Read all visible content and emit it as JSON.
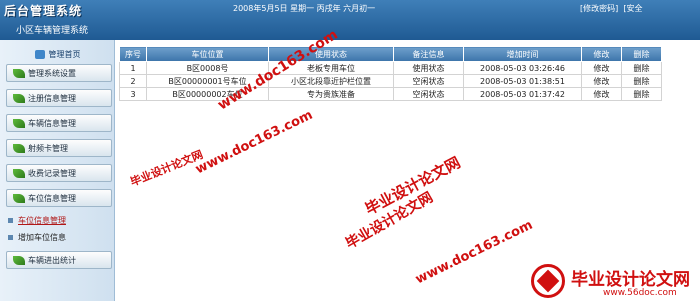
{
  "header": {
    "logo": "后台管理系统",
    "subtitle": "小区车辆管理系统",
    "date": "2008年5月5日  星期一  丙戌年  六月初一",
    "links": [
      "修改密码",
      "安全"
    ]
  },
  "sidebar": {
    "title": "管理首页",
    "menu": [
      {
        "label": "管理系统设置"
      },
      {
        "label": "注册信息管理"
      },
      {
        "label": "车辆信息管理"
      },
      {
        "label": "射频卡管理"
      },
      {
        "label": "收费记录管理"
      },
      {
        "label": "车位信息管理"
      }
    ],
    "sub": [
      {
        "label": "车位信息管理"
      },
      {
        "label": "增加车位信息"
      }
    ],
    "last": {
      "label": "车辆进出统计"
    }
  },
  "table": {
    "columns": [
      "序号",
      "车位位置",
      "使用状态",
      "备注信息",
      "增加时间",
      "修改",
      "删除"
    ],
    "rows": [
      {
        "no": "1",
        "position": "B区0008号",
        "status": "老板专用车位",
        "note": "使用状态",
        "time": "2008-05-03 03:26:46",
        "edit": "修改",
        "del": "删除"
      },
      {
        "no": "2",
        "position": "B区00000001号车位",
        "status": "小区北段靠近护栏位置",
        "note": "空闲状态",
        "time": "2008-05-03 01:38:51",
        "edit": "修改",
        "del": "删除"
      },
      {
        "no": "3",
        "position": "B区00000002车位",
        "status": "专为贵族准备",
        "note": "空闲状态",
        "time": "2008-05-03 01:37:42",
        "edit": "修改",
        "del": "删除"
      }
    ]
  },
  "watermarks": {
    "url": "www.doc163.com",
    "tagline": "毕业设计论文网"
  },
  "corner": {
    "title": "毕业设计论文网",
    "site": "www.56doc.com"
  }
}
